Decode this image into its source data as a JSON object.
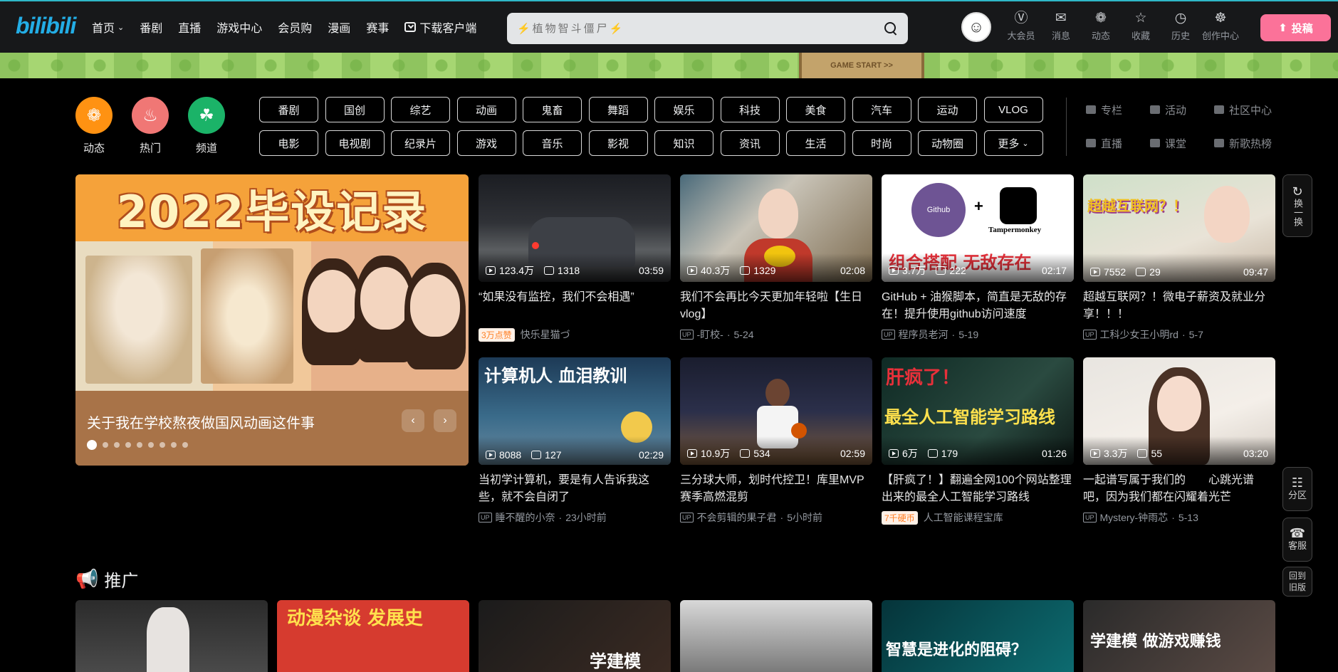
{
  "header": {
    "logo": "bilibili",
    "nav": [
      {
        "label": "首页",
        "has_chevron": true
      },
      {
        "label": "番剧"
      },
      {
        "label": "直播"
      },
      {
        "label": "游戏中心"
      },
      {
        "label": "会员购"
      },
      {
        "label": "漫画"
      },
      {
        "label": "赛事"
      },
      {
        "label": "下载客户端",
        "icon": "download-icon"
      }
    ],
    "search": {
      "placeholder": "⚡植物智斗僵尸⚡"
    },
    "entries": [
      {
        "label": "大会员",
        "icon": "vip-icon"
      },
      {
        "label": "消息",
        "icon": "message-icon"
      },
      {
        "label": "动态",
        "icon": "pinwheel-icon"
      },
      {
        "label": "收藏",
        "icon": "star-icon"
      },
      {
        "label": "历史",
        "icon": "clock-icon"
      },
      {
        "label": "创作中心",
        "icon": "lightbulb-icon"
      }
    ],
    "upload_label": "投稿"
  },
  "banner": {
    "sign_text": "GAME START >>"
  },
  "quick": [
    {
      "label": "动态",
      "color": "#ff9212",
      "icon": "pinwheel-icon"
    },
    {
      "label": "热门",
      "color": "#f07775",
      "icon": "flame-icon"
    },
    {
      "label": "频道",
      "color": "#1bb368",
      "icon": "channel-icon"
    }
  ],
  "channels": [
    "番剧",
    "国创",
    "综艺",
    "动画",
    "鬼畜",
    "舞蹈",
    "娱乐",
    "科技",
    "美食",
    "汽车",
    "运动",
    "VLOG",
    "电影",
    "电视剧",
    "纪录片",
    "游戏",
    "音乐",
    "影视",
    "知识",
    "资讯",
    "生活",
    "时尚",
    "动物圈",
    "更多"
  ],
  "side_links": [
    "专栏",
    "活动",
    "社区中心",
    "直播",
    "课堂",
    "新歌热榜"
  ],
  "carousel": {
    "headline": "2022毕设记录",
    "title": "关于我在学校熬夜做国风动画这件事",
    "dots": 9
  },
  "videos": [
    {
      "plays": "123.4万",
      "danmaku": "1318",
      "duration": "03:59",
      "title": "“如果没有监控，我们不会相遇”",
      "badge": "3万点赞",
      "author": "快乐星猫づ",
      "date": ""
    },
    {
      "plays": "40.3万",
      "danmaku": "1329",
      "duration": "02:08",
      "title": "我们不会再比今天更加年轻啦【生日vlog】",
      "badge": "",
      "author": "-盯校-",
      "date": "5-24"
    },
    {
      "plays": "3.7万",
      "danmaku": "222",
      "duration": "02:17",
      "title": "GitHub + 油猴脚本，简直是无敌的存在！提升使用github访问速度",
      "badge": "",
      "author": "程序员老河",
      "date": "5-19",
      "overlay": "组合搭配 无敌存在",
      "logo1": "Github",
      "logo2": "Tampermonkey"
    },
    {
      "plays": "7552",
      "danmaku": "29",
      "duration": "09:47",
      "title": "超越互联网？！微电子薪资及就业分享！！！",
      "badge": "",
      "author": "工科少女王小明rd",
      "date": "5-7",
      "overlay": "超越互联网？！"
    },
    {
      "plays": "8088",
      "danmaku": "127",
      "duration": "02:29",
      "title": "当初学计算机，要是有人告诉我这些，就不会自闭了",
      "badge": "",
      "author": "睡不醒的小奈",
      "date": "23小时前",
      "overlay": "计算机人 血泪教训"
    },
    {
      "plays": "10.9万",
      "danmaku": "534",
      "duration": "02:59",
      "title": "三分球大师，划时代控卫！库里MVP赛季高燃混剪",
      "badge": "",
      "author": "不会剪辑的果子君",
      "date": "5小时前"
    },
    {
      "plays": "6万",
      "danmaku": "179",
      "duration": "01:26",
      "title": "【肝疯了！】翻遍全网100个网站整理出来的最全人工智能学习路线",
      "badge": "7千硬币",
      "author": "人工智能课程宝库",
      "date": "",
      "overlay": "最全人工智能学习路线"
    },
    {
      "plays": "3.3万",
      "danmaku": "55",
      "duration": "03:20",
      "title": "一起谱写属于我们的　　心跳光谱　　吧，因为我们都在闪耀着光芒",
      "badge": "",
      "author": "Mystery-钟雨芯",
      "date": "5-13"
    }
  ],
  "float": {
    "refresh": "换一换",
    "zone": "分区",
    "service": "客服",
    "old": "回到旧版"
  },
  "promo": {
    "title": "推广",
    "cards": [
      "",
      "动漫杂谈 发展史",
      "学建模",
      "",
      "智慧是进化的阻碍？",
      "学建模 做游戏赚钱"
    ]
  }
}
